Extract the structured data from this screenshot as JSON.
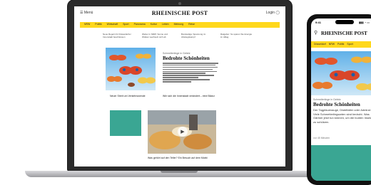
{
  "laptop": {
    "header": {
      "menu_label": "☰ Menü",
      "logo": "RHEINISCHE POST",
      "login_label": "Login ◯"
    },
    "nav_items": [
      "NRW",
      "Politik",
      "Wirtschaft",
      "Sport",
      "Panorama",
      "Kultur",
      "Leben",
      "Meinung",
      "Reise"
    ],
    "teasers": [
      "Neue Regeln für Düsseldorfer Innenstadt beschlossen",
      "Wetter in NRW: Sonne und Wolken wechseln sich ab",
      "Bundesliga: Spannung im Abstiegskampf",
      "Ratgeber: So sparen Sie Energie im Alltag"
    ],
    "hero": {
      "kicker": "Schmetterlinge in Gefahr",
      "title": "Bedrohte Schönheiten"
    },
    "small_story_1": "Neuer Streit um Verkehrswende",
    "small_story_2": "Wie sich die Innenstadt verändert – eine Bilanz",
    "food_caption": "Was gehört auf den Teller? Ein Besuch auf dem Markt"
  },
  "phone": {
    "status_time": "9:41",
    "status_icons": "▮▮▮ ◔ ▭",
    "logo": "RHEINISCHE POST",
    "nav_items": [
      "Düsseldorf",
      "NRW",
      "Politik",
      "Sport"
    ],
    "kicker": "Schmetterlinge in Gefahr",
    "title": "Bedrohte Schönheiten",
    "body": "Der Tagpfauenauge, Distelfalter oder Admiral: Viele Schmetterlingsarten sind bedroht. Was Gärtner jetzt tun können, um die bunten Insekten zu schützen.",
    "meta": "vor 45 Minuten"
  },
  "colors": {
    "accent_yellow": "#ffd81c",
    "teal": "#3aa693",
    "sky_blue": "#8fc8ee"
  }
}
